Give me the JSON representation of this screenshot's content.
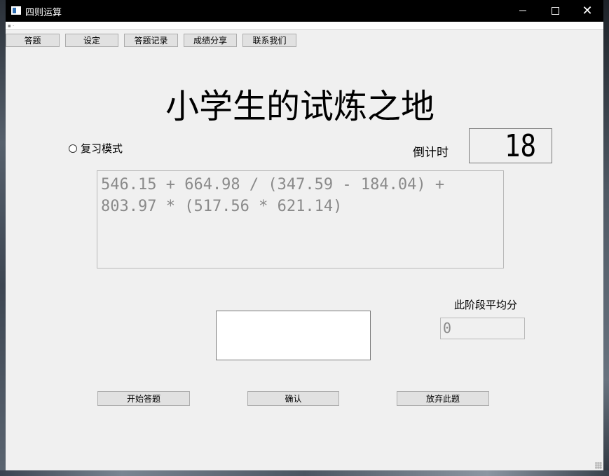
{
  "window": {
    "title": "四则运算",
    "controls": {
      "minimize": "minimize",
      "maximize": "maximize",
      "close": "✕"
    }
  },
  "nav": [
    {
      "label": "答题"
    },
    {
      "label": "设定"
    },
    {
      "label": "答题记录"
    },
    {
      "label": "成绩分享"
    },
    {
      "label": "联系我们"
    }
  ],
  "main": {
    "heading": "小学生的试炼之地",
    "review_mode_label": "复习模式",
    "review_mode_checked": false,
    "countdown_label": "倒计时",
    "countdown_value": "18",
    "question_line1": "546.15 + 664.98 / (347.59 - 184.04) +",
    "question_line2": "803.97 * (517.56 * 621.14)",
    "avg_label": "此阶段平均分",
    "avg_value": "0",
    "answer_value": ""
  },
  "actions": {
    "start": "开始答题",
    "confirm": "确认",
    "skip": "放弃此题"
  },
  "colors": {
    "titlebar": "#000000",
    "window_bg": "#f0f0f0",
    "button_bg": "#e1e1e1",
    "readonly_text": "#8a8a8a"
  }
}
